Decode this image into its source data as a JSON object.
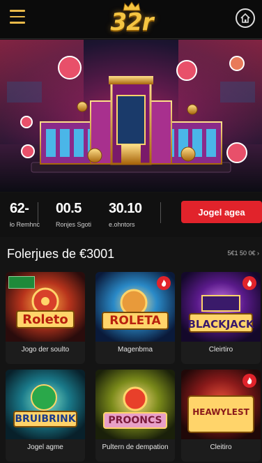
{
  "app": {
    "logo_text": "32r",
    "icons": {
      "menu": "hamburger-menu-icon",
      "home": "home-icon",
      "logo": "crown-icon"
    }
  },
  "stats": [
    {
      "value": "62-",
      "label": "ło Remhnc"
    },
    {
      "value": "00.5",
      "label": "Ronjes Sgoti"
    },
    {
      "value": "30.10",
      "label": "e.ohntors"
    }
  ],
  "cta": {
    "label": "Jogel agea"
  },
  "section": {
    "title": "Folerjues de €3001",
    "more": "5€1 50 0€ ›"
  },
  "games": [
    {
      "title": "Roleto",
      "name": "Jogo der soulto",
      "badge": "",
      "theme": "#c44a1c"
    },
    {
      "title": "ROLETA",
      "name": "Magenbma",
      "badge": "hot",
      "theme": "#1e6aa5"
    },
    {
      "title": "BLACKJACK",
      "name": "Cleirtiro",
      "badge": "hot",
      "theme": "#6a2a9e"
    },
    {
      "title": "BRUIBRINK",
      "name": "Jogel agme",
      "badge": "",
      "theme": "#1c7a8a"
    },
    {
      "title": "PROONCS",
      "name": "Pultern de dempation",
      "badge": "",
      "theme": "#6a7a1a"
    },
    {
      "title": "HEAWYLEST",
      "name": "Cleitiro",
      "badge": "hot",
      "theme": "#8a1a1a"
    }
  ],
  "colors": {
    "accent": "#e1232b",
    "gold": "#f5c542",
    "bg": "#141414"
  }
}
